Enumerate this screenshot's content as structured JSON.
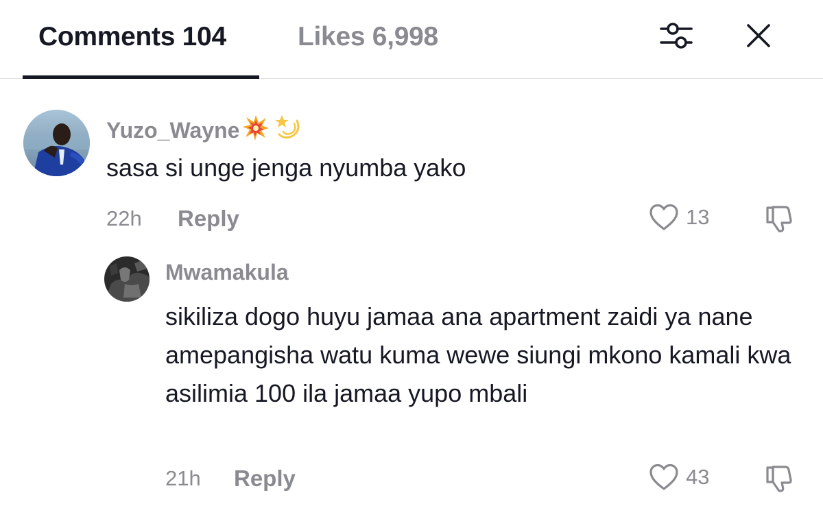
{
  "header": {
    "tabs": [
      {
        "label": "Comments 104"
      },
      {
        "label": "Likes 6,998"
      }
    ],
    "filter_icon": "sliders-icon",
    "close_icon": "close-icon"
  },
  "comments": [
    {
      "username": "Yuzo_Wayne",
      "username_emojis": [
        "collision-emoji",
        "dizzy-emoji"
      ],
      "text": "sasa si unge jenga nyumba yako",
      "time": "22h",
      "reply_label": "Reply",
      "likes": "13",
      "avatar": "avatar-photo-person-blue-shirt"
    },
    {
      "username": "Mwamakula",
      "text": "sikiliza dogo huyu jamaa ana apartment zaidi ya nane amepangisha watu kuma wewe siungi mkono kamali kwa asilimia 100 ila jamaa yupo mbali",
      "time": "21h",
      "reply_label": "Reply",
      "likes": "43",
      "avatar": "avatar-photo-dark-grayscale",
      "is_reply": true
    }
  ],
  "colors": {
    "primary_text": "#161823",
    "secondary_text": "#8a8b91",
    "divider": "#e3e3e4"
  }
}
